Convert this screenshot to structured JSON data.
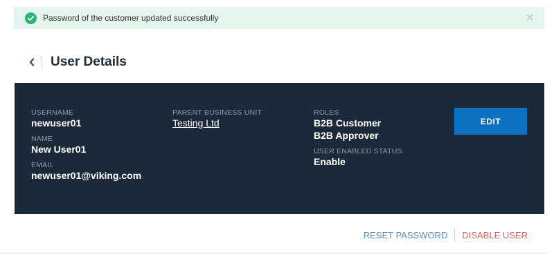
{
  "alert": {
    "message": "Password of the customer updated successfully",
    "icon": "check-circle-icon",
    "close_icon": "close-icon",
    "accent": "#2bb673"
  },
  "header": {
    "title": "User Details",
    "back_icon": "chevron-left-icon"
  },
  "details": {
    "username_label": "USERNAME",
    "username": "newuser01",
    "name_label": "NAME",
    "name": "New User01",
    "email_label": "EMAIL",
    "email": "newuser01@viking.com",
    "parent_bu_label": "PARENT BUSINESS UNIT",
    "parent_bu": "Testing Ltd",
    "roles_label": "ROLES",
    "roles": [
      "B2B Customer",
      "B2B Approver"
    ],
    "status_label": "USER ENABLED STATUS",
    "status": "Enable",
    "edit_label": "EDIT",
    "panel_color": "#1b2a3b",
    "button_color": "#0c71c3"
  },
  "actions": {
    "reset_password": "RESET PASSWORD",
    "disable_user": "DISABLE USER",
    "reset_color": "#5b8fbf",
    "disable_color": "#e06162"
  }
}
